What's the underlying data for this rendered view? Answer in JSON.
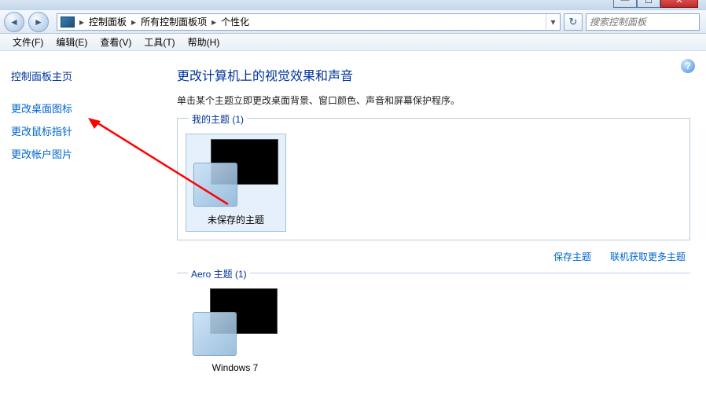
{
  "breadcrumbs": [
    "控制面板",
    "所有控制面板项",
    "个性化"
  ],
  "search": {
    "placeholder": "搜索控制面板"
  },
  "menus": [
    "文件(F)",
    "编辑(E)",
    "查看(V)",
    "工具(T)",
    "帮助(H)"
  ],
  "sidebar": {
    "header": "控制面板主页",
    "links": [
      "更改桌面图标",
      "更改鼠标指针",
      "更改帐户图片"
    ]
  },
  "content": {
    "title": "更改计算机上的视觉效果和声音",
    "subtitle": "单击某个主题立即更改桌面背景、窗口颜色、声音和屏幕保护程序。"
  },
  "group1": {
    "label": "我的主题 (1)",
    "themes": [
      {
        "name": "未保存的主题"
      }
    ],
    "actions": [
      "保存主题",
      "联机获取更多主题"
    ]
  },
  "group2": {
    "label": "Aero 主题 (1)",
    "themes": [
      {
        "name": "Windows 7"
      }
    ]
  }
}
